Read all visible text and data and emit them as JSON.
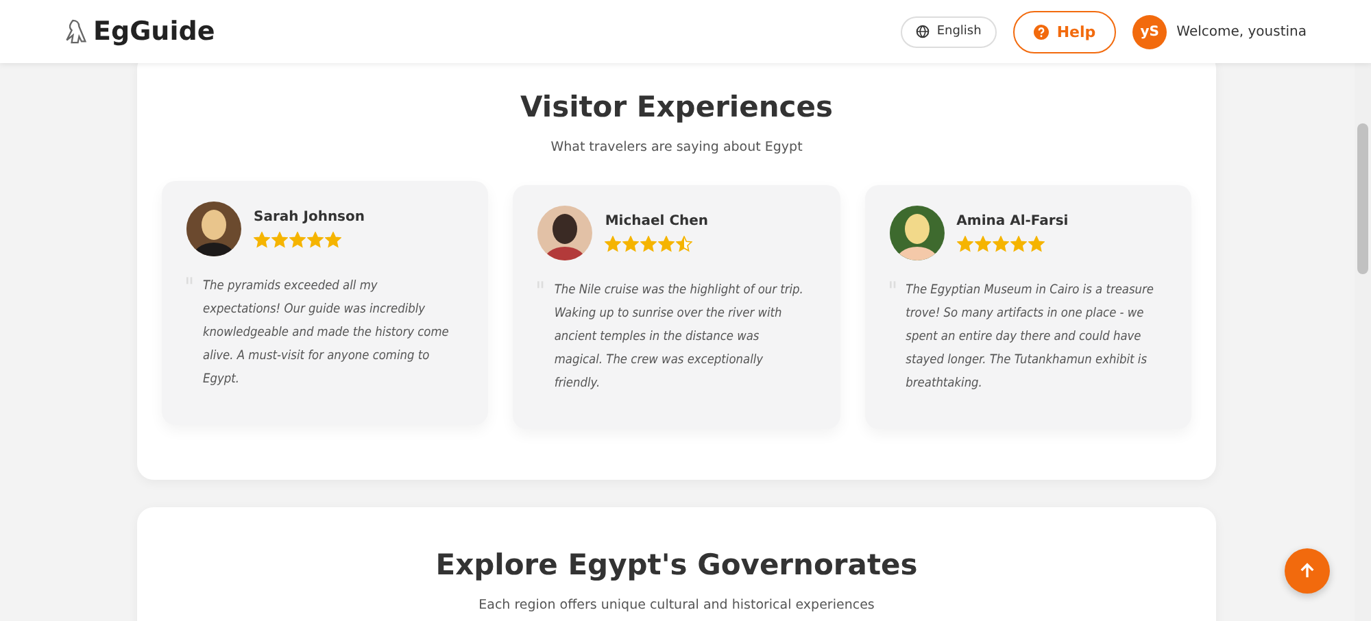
{
  "header": {
    "brand": "EgGuide",
    "language": "English",
    "help": "Help",
    "avatar_initials": "yS",
    "welcome": "Welcome, youstina"
  },
  "testimonials": {
    "title": "Visitor Experiences",
    "subtitle": "What travelers are saying about Egypt",
    "reviews": [
      {
        "name": "Sarah Johnson",
        "stars": 5,
        "quote": "The pyramids exceeded all my expectations! Our guide was incredibly knowledgeable and made the history come alive. A must-visit for anyone coming to Egypt."
      },
      {
        "name": "Michael Chen",
        "stars": 4.5,
        "quote": "The Nile cruise was the highlight of our trip. Waking up to sunrise over the river with ancient temples in the distance was magical. The crew was exceptionally friendly."
      },
      {
        "name": "Amina Al-Farsi",
        "stars": 5,
        "quote": "The Egyptian Museum in Cairo is a treasure trove! So many artifacts in one place - we spent an entire day there and could have stayed longer. The Tutankhamun exhibit is breathtaking."
      }
    ]
  },
  "governorates": {
    "title": "Explore Egypt's Governorates",
    "subtitle": "Each region offers unique cultural and historical experiences"
  }
}
